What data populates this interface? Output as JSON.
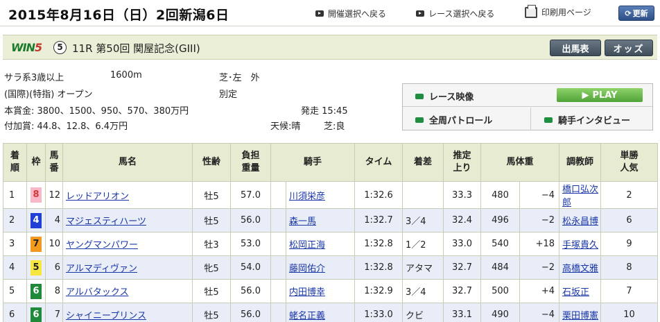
{
  "top": {
    "date_title": "2015年8月16日（日）2回新潟6日",
    "link_kaisai": "開催選択へ戻る",
    "link_race": "レース選択へ戻る",
    "link_print": "印刷用ページ",
    "refresh": "更新"
  },
  "race": {
    "win5_logo": "WIN5",
    "leg_number": "5",
    "name": "11R 第50回 関屋記念(GIII)",
    "btn_entries": "出馬表",
    "btn_odds": "オッズ",
    "class": "サラ系3歳以上",
    "distance": "1600m",
    "course": "芝･左　外",
    "conditions": "(国際)(特指) オープン",
    "weight_rule": "別定",
    "prize": "本賞金:  3800、1500、950、570、380万円",
    "start": "発走 15:45",
    "added_prize": "付加賞:  44.8、12.8、6.4万円",
    "weather": "天候:晴",
    "track": "芝:良"
  },
  "video": {
    "race_video": "レース映像",
    "play": "PLAY",
    "patrol": "全周パトロール",
    "jockey_interview": "騎手インタビュー"
  },
  "table": {
    "headers": {
      "rank": [
        "着",
        "順"
      ],
      "frame": "枠",
      "num": [
        "馬",
        "番"
      ],
      "horse": "馬名",
      "sexage": "性齢",
      "weight": [
        "負担",
        "重量"
      ],
      "jockey": "騎手",
      "time": "タイム",
      "margin": "着差",
      "last3f": [
        "推定",
        "上り"
      ],
      "bodyweight": "馬体重",
      "trainer": "調教師",
      "pop": [
        "単勝",
        "人気"
      ]
    },
    "frame_colors": {
      "8": {
        "bg": "#f7b8c8",
        "fg": "#d23a3a"
      },
      "4": {
        "bg": "#1f3fd6",
        "fg": "#ffffff"
      },
      "7": {
        "bg": "#f29a1e",
        "fg": "#222222"
      },
      "5": {
        "bg": "#f5e640",
        "fg": "#222222"
      },
      "6": {
        "bg": "#1f8a3a",
        "fg": "#ffffff"
      }
    },
    "rows": [
      {
        "rank": "1",
        "frame": "8",
        "num": "12",
        "horse": "レッドアリオン",
        "sexage": "牡5",
        "weight": "57.0",
        "jockey": "川須栄彦",
        "time": "1:32.6",
        "margin": "",
        "last3f": "33.3",
        "bw": "480",
        "bwd": "−4",
        "trainer": "橋口弘次郎",
        "pop": "2"
      },
      {
        "rank": "2",
        "frame": "4",
        "num": "4",
        "horse": "マジェスティハーツ",
        "sexage": "牡5",
        "weight": "56.0",
        "jockey": "森一馬",
        "time": "1:32.7",
        "margin": "3／4",
        "last3f": "32.4",
        "bw": "496",
        "bwd": "−2",
        "trainer": "松永昌博",
        "pop": "6"
      },
      {
        "rank": "3",
        "frame": "7",
        "num": "10",
        "horse": "ヤングマンパワー",
        "sexage": "牡3",
        "weight": "53.0",
        "jockey": "松岡正海",
        "time": "1:32.8",
        "margin": "1／2",
        "last3f": "33.0",
        "bw": "540",
        "bwd": "+18",
        "trainer": "手塚貴久",
        "pop": "9"
      },
      {
        "rank": "4",
        "frame": "5",
        "num": "6",
        "horse": "アルマディヴァン",
        "sexage": "牝5",
        "weight": "54.0",
        "jockey": "藤岡佑介",
        "time": "1:32.8",
        "margin": "アタマ",
        "last3f": "32.7",
        "bw": "484",
        "bwd": "−2",
        "trainer": "高橋文雅",
        "pop": "8"
      },
      {
        "rank": "5",
        "frame": "6",
        "num": "8",
        "horse": "アルバタックス",
        "sexage": "牡5",
        "weight": "56.0",
        "jockey": "内田博幸",
        "time": "1:32.9",
        "margin": "3／4",
        "last3f": "32.7",
        "bw": "500",
        "bwd": "+4",
        "trainer": "石坂正",
        "pop": "7"
      },
      {
        "rank": "6",
        "frame": "6",
        "num": "7",
        "horse": "シャイニープリンス",
        "sexage": "牡5",
        "weight": "56.0",
        "jockey": "蛯名正義",
        "time": "1:33.0",
        "margin": "クビ",
        "last3f": "33.1",
        "bw": "490",
        "bwd": "−4",
        "trainer": "栗田博憲",
        "pop": "10"
      }
    ]
  }
}
